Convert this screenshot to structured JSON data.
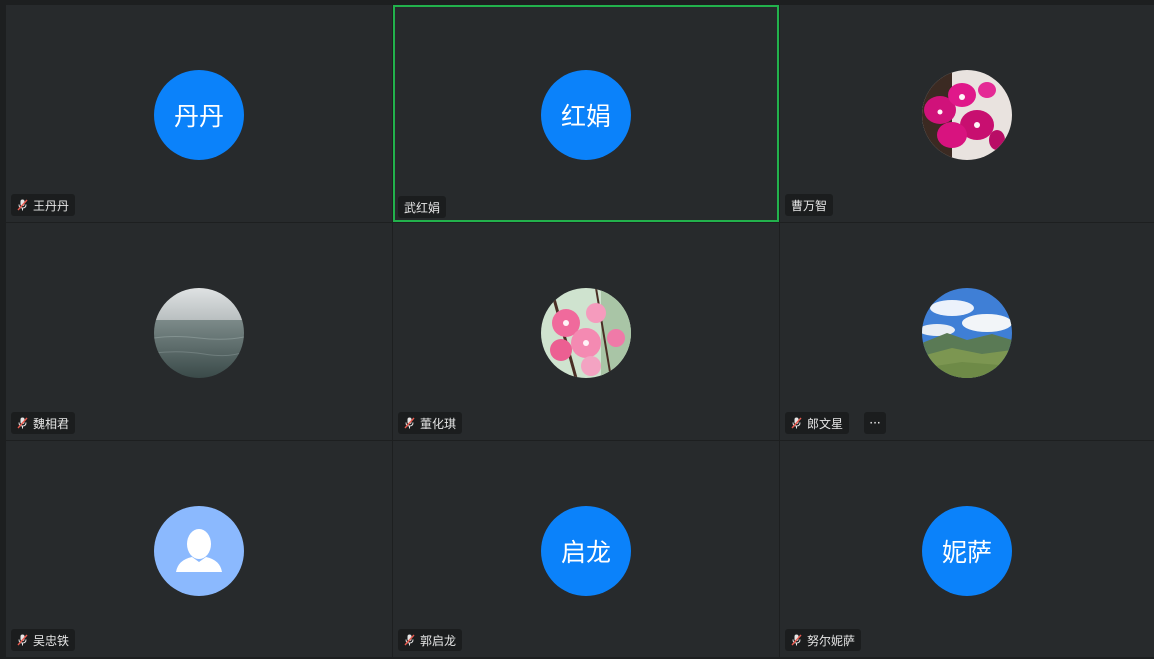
{
  "participants": [
    {
      "name": "王丹丹",
      "initials": "丹丹",
      "muted": true,
      "avatar_type": "initials"
    },
    {
      "name": "武红娟",
      "initials": "红娟",
      "muted": false,
      "active_speaker": true,
      "avatar_type": "initials"
    },
    {
      "name": "曹万智",
      "muted": false,
      "avatar_type": "photo",
      "photo": "pink-orchid-flowers"
    },
    {
      "name": "魏相君",
      "muted": true,
      "avatar_type": "photo",
      "photo": "grey-sea"
    },
    {
      "name": "董化琪",
      "muted": true,
      "avatar_type": "photo",
      "photo": "pink-blossoms"
    },
    {
      "name": "郎文星",
      "muted": true,
      "avatar_type": "photo",
      "photo": "mountain-landscape",
      "more_label": "···"
    },
    {
      "name": "吴忠铁",
      "muted": true,
      "avatar_type": "default-person"
    },
    {
      "name": "郭启龙",
      "initials": "启龙",
      "muted": true,
      "avatar_type": "initials"
    },
    {
      "name": "努尔妮萨",
      "initials": "妮萨",
      "muted": true,
      "avatar_type": "initials"
    }
  ],
  "colors": {
    "avatar_blue": "#0b82fa",
    "default_avatar_blue": "#8bb9fe",
    "active_speaker_border": "#22b14c",
    "tile_bg": "#272a2c",
    "muted_icon": "#e85a4f"
  }
}
